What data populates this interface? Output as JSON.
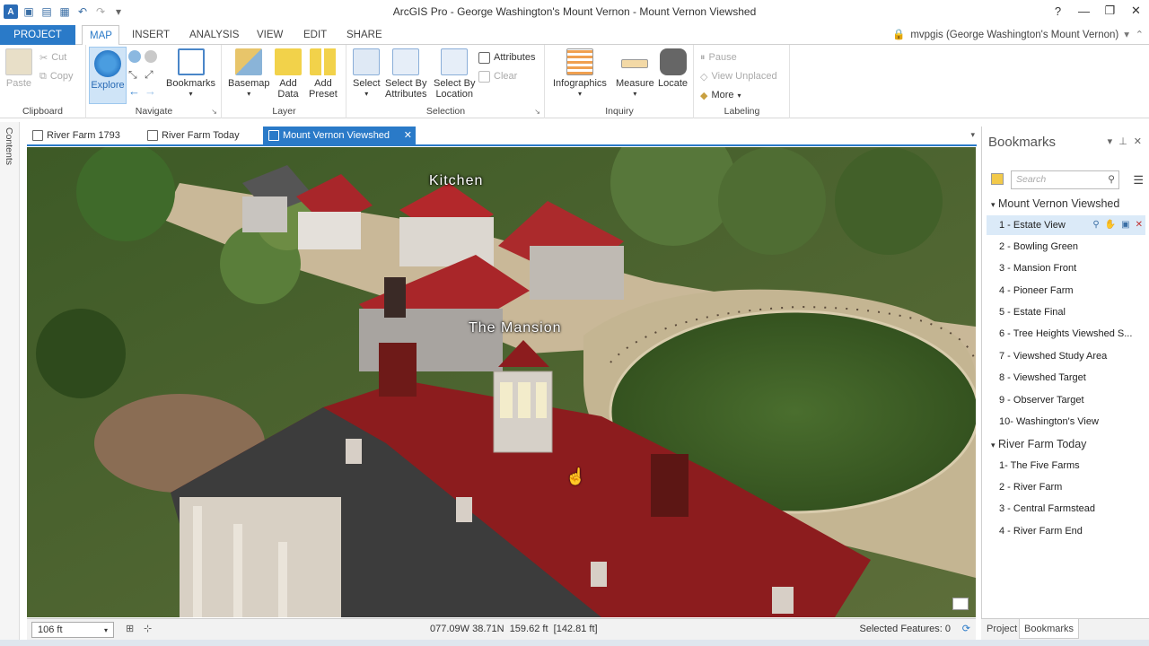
{
  "window": {
    "title": "ArcGIS Pro - George Washington's Mount Vernon - Mount Vernon Viewshed",
    "help": "?",
    "minimize": "—",
    "restore": "❐",
    "close": "✕"
  },
  "ribbon_tabs": [
    "PROJECT",
    "MAP",
    "INSERT",
    "ANALYSIS",
    "VIEW",
    "EDIT",
    "SHARE"
  ],
  "user_label": "mvpgis (George Washington's Mount Vernon)",
  "ribbon": {
    "clipboard": {
      "paste": "Paste",
      "cut": "Cut",
      "copy": "Copy",
      "label": "Clipboard"
    },
    "navigate": {
      "explore": "Explore",
      "bookmarks": "Bookmarks",
      "label": "Navigate"
    },
    "layer": {
      "basemap": "Basemap",
      "add_data": "Add\nData",
      "add_preset": "Add\nPreset",
      "label": "Layer"
    },
    "selection": {
      "select": "Select",
      "by_attributes": "Select By\nAttributes",
      "by_location": "Select By\nLocation",
      "attributes": "Attributes",
      "clear": "Clear",
      "label": "Selection"
    },
    "inquiry": {
      "infographics": "Infographics",
      "measure": "Measure",
      "locate": "Locate",
      "label": "Inquiry"
    },
    "labeling": {
      "pause": "Pause",
      "view_unplaced": "View Unplaced",
      "more": "More",
      "label": "Labeling"
    }
  },
  "view_tabs": [
    {
      "label": "River Farm 1793"
    },
    {
      "label": "River Farm Today"
    },
    {
      "label": "Mount Vernon Viewshed",
      "active": true
    }
  ],
  "contents_label": "Contents",
  "map_labels": {
    "kitchen": "Kitchen",
    "mansion": "The Mansion"
  },
  "status": {
    "scale": "106 ft",
    "coords": "077.09W 38.71N",
    "elevation": "159.62 ft",
    "elevation2": "[142.81 ft]",
    "selected": "Selected Features: 0"
  },
  "bookmarks_pane": {
    "title": "Bookmarks",
    "search_placeholder": "Search",
    "groups": [
      {
        "name": "Mount Vernon Viewshed",
        "items": [
          "1 - Estate View",
          "2 - Bowling Green",
          "3 - Mansion Front",
          "4 - Pioneer Farm",
          "5 - Estate Final",
          "6 - Tree Heights Viewshed S...",
          "7 - Viewshed Study Area",
          "8 - Viewshed Target",
          "9 - Observer Target",
          "10- Washington's View"
        ]
      },
      {
        "name": "River Farm Today",
        "items": [
          "1- The Five Farms",
          "2 - River Farm",
          "3 - Central Farmstead",
          "4 - River Farm End"
        ]
      }
    ],
    "footer_tabs": [
      "Project",
      "Bookmarks"
    ]
  },
  "colors": {
    "accent": "#2a7ac8",
    "roof": "#8c1c1e",
    "lawn": "#3f5e28"
  }
}
